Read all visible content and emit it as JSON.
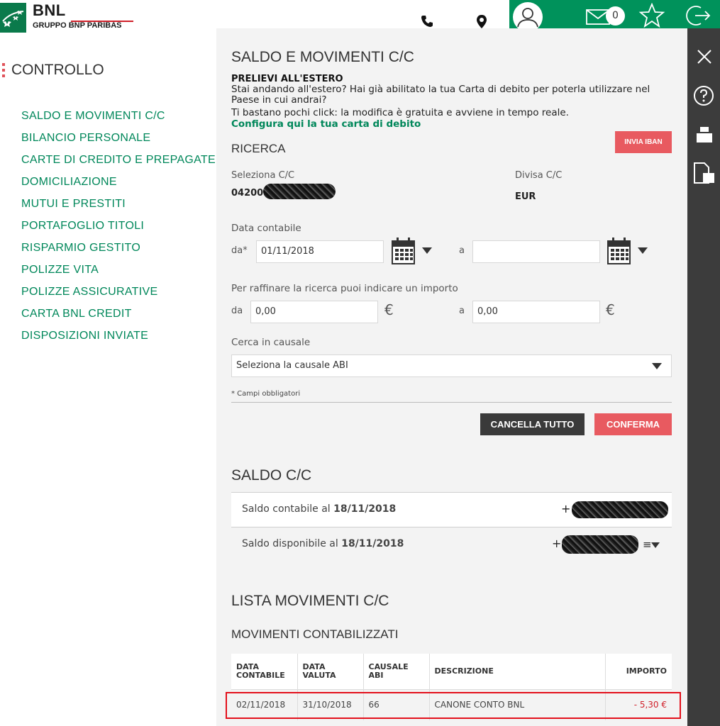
{
  "header": {
    "logo_title": "BNL",
    "logo_subtitle": "GRUPPO BNP PARIBAS",
    "message_count": "0",
    "accent_green": "#00925b"
  },
  "nav": {
    "title": "CONTROLLO",
    "items": [
      "SALDO E MOVIMENTI C/C",
      "BILANCIO PERSONALE",
      "CARTE DI CREDITO E PREPAGATE",
      "DOMICILIAZIONE",
      "MUTUI E PRESTITI",
      "PORTAFOGLIO TITOLI",
      "RISPARMIO GESTITO",
      "POLIZZE VITA",
      "POLIZZE ASSICURATIVE",
      "CARTA BNL CREDIT",
      "DISPOSIZIONI INVIATE"
    ]
  },
  "panel": {
    "title": "SALDO E MOVIMENTI C/C",
    "notice_title": "PRELIEVI ALL'ESTERO",
    "notice_line1": "Stai andando all'estero? Hai già abilitato la tua Carta di debito per poterla utilizzare nel Paese in cui andrai?",
    "notice_line2": "Ti bastano pochi click: la modifica è gratuita e avviene in tempo reale.",
    "notice_link": "Configura qui la tua carta di debito",
    "ricerca": "RICERCA",
    "invia_iban": "INVIA IBAN",
    "seleziona_cc_label": "Seleziona C/C",
    "cc_value": "04200",
    "divisa_label": "Divisa C/C",
    "divisa_value": "EUR",
    "data_contabile_label": "Data contabile",
    "da_required": "da*",
    "date_from": "01/11/2018",
    "a": "a",
    "date_to": "",
    "importo_label": "Per raffinare la ricerca puoi indicare un importo",
    "da": "da",
    "amount_from": "0,00",
    "amount_to": "0,00",
    "euro": "€",
    "causale_label": "Cerca in causale",
    "causale_select": "Seleziona la causale ABI",
    "required_note": "* Campi obbligatori",
    "cancel_btn": "CANCELLA TUTTO",
    "confirm_btn": "CONFERMA"
  },
  "saldo": {
    "title": "SALDO C/C",
    "contabile_prefix": "Saldo contabile al",
    "contabile_date": "18/11/2018",
    "disponibile_prefix": "Saldo disponibile al",
    "disponibile_date": "18/11/2018",
    "plus": "+",
    "menu_glyph": "≡"
  },
  "lista": {
    "title": "LISTA MOVIMENTI C/C",
    "subtitle": "MOVIMENTI CONTABILIZZATI",
    "headers": [
      "DATA CONTABILE",
      "DATA VALUTA",
      "CAUSALE ABI",
      "DESCRIZIONE",
      "IMPORTO"
    ],
    "rows": [
      [
        "02/11/2018",
        "31/10/2018",
        "66",
        "CANONE CONTO BNL",
        "- 5,30  €"
      ]
    ]
  }
}
